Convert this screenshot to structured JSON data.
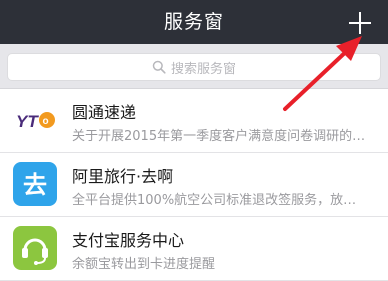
{
  "header": {
    "title": "服务窗",
    "plus_icon": "plus-icon"
  },
  "search": {
    "placeholder": "搜索服务窗",
    "icon": "search-icon"
  },
  "colors": {
    "navbar": "#2d3038",
    "annotation_arrow": "#e8202a",
    "yto_purple": "#4a2b7a",
    "yto_orange": "#f29a1f",
    "alitrip_blue": "#2fa4ea",
    "alipay_green": "#8cc63f"
  },
  "services": [
    {
      "title": "圆通速递",
      "description": "关于开展2015年第一季度客户满意度问卷调研的…",
      "icon": "yto-logo-icon",
      "logo_text": "YT"
    },
    {
      "title": "阿里旅行·去啊",
      "description": "全平台提供100%航空公司标准退改签服务，放…",
      "icon": "alitrip-logo-icon",
      "logo_text": "去"
    },
    {
      "title": "支付宝服务中心",
      "description": "余额宝转出到卡进度提醒",
      "icon": "alipay-service-headset-icon"
    }
  ]
}
